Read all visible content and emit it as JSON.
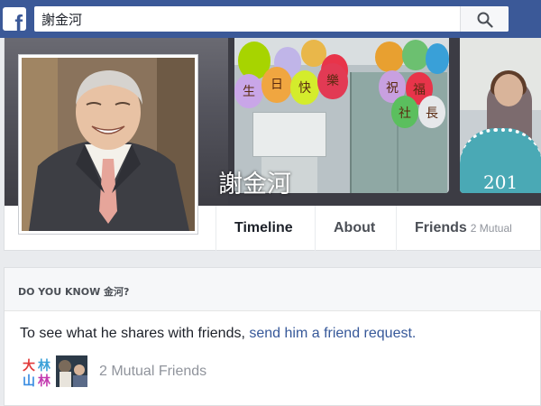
{
  "header": {
    "logo": "f",
    "search_value": "謝金河",
    "search_icon": "search-icon",
    "brand_color": "#3b5998"
  },
  "profile": {
    "name": "謝金河",
    "cover_year": "201",
    "balloon_chars": [
      "生",
      "日",
      "快",
      "樂",
      "祝",
      "福",
      "社",
      "長"
    ]
  },
  "tabs": {
    "timeline": "Timeline",
    "about": "About",
    "friends": "Friends",
    "friends_count": "2 Mutual"
  },
  "know": {
    "title": "DO YOU KNOW 金河?",
    "text": "To see what he shares with friends, ",
    "link": "send him a friend request.",
    "mutual_friends": "2 Mutual Friends",
    "thumb_chars": [
      "大",
      "林",
      "山",
      "林"
    ]
  }
}
